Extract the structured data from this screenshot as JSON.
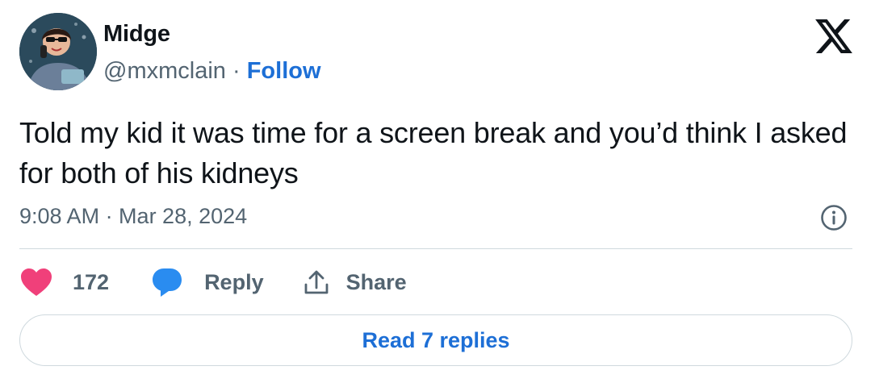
{
  "author": {
    "name": "Midge",
    "handle": "@mxmclain",
    "separator": "·",
    "follow_label": "Follow"
  },
  "tweet": {
    "text": "Told my kid it was time for a screen break and you’d think I asked for both of his kidneys",
    "timestamp": "9:08 AM · Mar 28, 2024"
  },
  "actions": {
    "like_count": "172",
    "reply_label": "Reply",
    "share_label": "Share"
  },
  "footer": {
    "read_replies_label": "Read 7 replies"
  },
  "icons": {
    "brand": "x-logo-icon",
    "info": "info-icon",
    "like": "heart-icon",
    "reply": "speech-bubble-icon",
    "share": "share-upload-icon"
  },
  "colors": {
    "link": "#1d6fd6",
    "heart": "#f0407a",
    "reply_bubble": "#2a8cf0",
    "muted": "#536471",
    "text": "#0f1419"
  }
}
